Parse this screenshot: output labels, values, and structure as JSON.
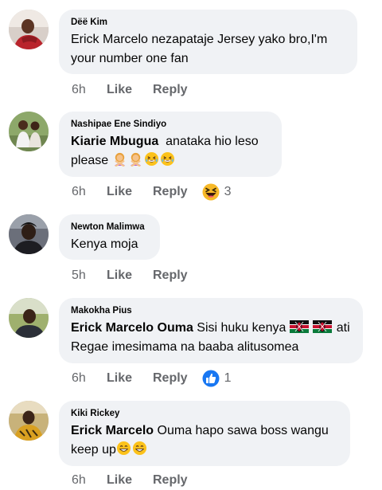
{
  "comments": [
    {
      "author": "Dëë Kim",
      "text": "Erick Marcelo nezapataje Jersey yako bro,I'm your number one fan",
      "time": "6h",
      "like": "Like",
      "reply": "Reply"
    },
    {
      "author": "Nashipae Ene Sindiyo",
      "mention": "Kiarie Mbugua",
      "text": "anataka hio leso please",
      "emojis": [
        "woman-gesturing-no",
        "woman-gesturing-no",
        "laughing-face",
        "laughing-face"
      ],
      "time": "6h",
      "like": "Like",
      "reply": "Reply",
      "reaction": {
        "icon": "haha-reaction",
        "count": "3"
      }
    },
    {
      "author": "Newton Malimwa",
      "text": "Kenya moja",
      "time": "5h",
      "like": "Like",
      "reply": "Reply"
    },
    {
      "author": "Makokha Pius",
      "mention": "Erick Marcelo Ouma",
      "text_part1": "Sisi huku kenya",
      "flags": [
        "kenya-flag",
        "kenya-flag"
      ],
      "text_part2": "ati",
      "text_line2": "Regae imesimama na baaba alitusomea",
      "time": "6h",
      "like": "Like",
      "reply": "Reply",
      "reaction": {
        "icon": "like-reaction",
        "count": "1"
      }
    },
    {
      "author": "Kiki Rickey",
      "mention": "Erick Marcelo",
      "text_line1": "Ouma hapo sawa boss wangu",
      "text_line2": "keep up",
      "emojis": [
        "grinning-face",
        "grinning-face"
      ],
      "time": "6h",
      "like": "Like",
      "reply": "Reply"
    }
  ],
  "colors": {
    "bubble": "#f0f2f5",
    "meta_text": "#65676b",
    "like_blue": "#1877f2",
    "haha_yellow": "#f7b928"
  }
}
